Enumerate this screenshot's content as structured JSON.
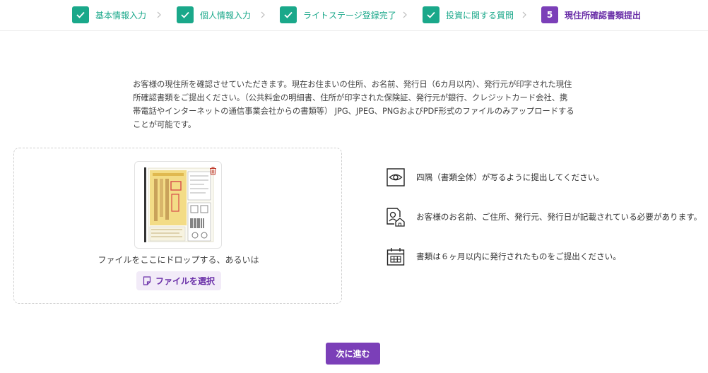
{
  "steps": [
    {
      "label": "基本情報入力",
      "status": "done"
    },
    {
      "label": "個人情報入力",
      "status": "done"
    },
    {
      "label": "ライトステージ登録完了",
      "status": "done"
    },
    {
      "label": "投資に関する質問",
      "status": "done"
    },
    {
      "label": "現住所確認書類提出",
      "status": "active",
      "number": "5"
    }
  ],
  "description": "お客様の現住所を確認させていただきます。現在お住まいの住所、お名前、発行日（6カ月以内）、発行元が印字された現住所確認書類をご提出ください。（公共料金の明細書、住所が印字された保険証、発行元が銀行、クレジットカード会社、携帯電話やインターネットの通信事業会社からの書類等） JPG、JPEG、PNGおよびPDF形式のファイルのみアップロードすることが可能です。",
  "dropzone": {
    "drop_text": "ファイルをここにドロップする、あるいは",
    "select_button": "ファイルを選択"
  },
  "tips": [
    {
      "icon": "eye-icon",
      "text": "四隅（書類全体）が写るように提出してください。"
    },
    {
      "icon": "person-home-icon",
      "text": "お客様のお名前、ご住所、発行元、発行日が記載されている必要があります。"
    },
    {
      "icon": "calendar-icon",
      "text": "書類は６ヶ月以内に発行されたものをご提出ください。"
    }
  ],
  "next_button": "次に進む",
  "colors": {
    "step_done": "#1aa88a",
    "step_active": "#7b3fb8",
    "primary": "#7b3fb8"
  }
}
